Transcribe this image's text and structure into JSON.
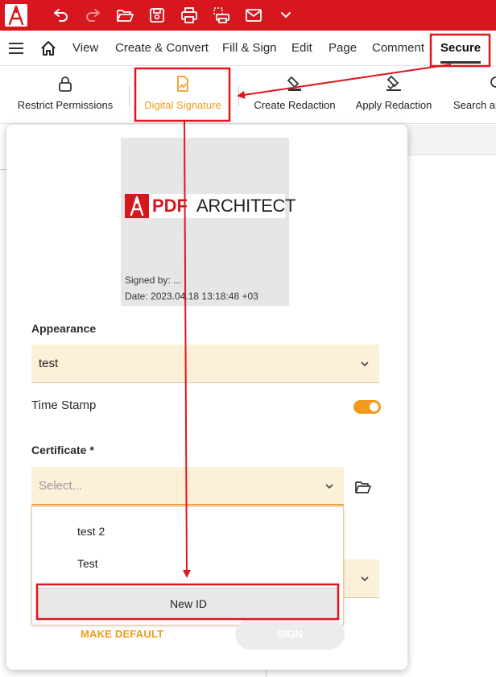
{
  "titlebar": {
    "icons": [
      "app-logo-icon",
      "undo-icon",
      "redo-icon",
      "open-folder-icon",
      "save-icon",
      "print-icon",
      "scan-print-icon",
      "mail-icon",
      "chevron-down-icon"
    ],
    "accent": "#d7161e"
  },
  "menu": {
    "items": [
      "View",
      "Create & Convert",
      "Fill & Sign",
      "Edit",
      "Page",
      "Comment",
      "Secure"
    ],
    "active": "Secure"
  },
  "ribbon": {
    "tools": [
      "Restrict Permissions",
      "Digital Signature",
      "Create Redaction",
      "Apply Redaction",
      "Search ar"
    ]
  },
  "panel": {
    "preview": {
      "brand_pdf": "PDF",
      "brand_arch": "ARCHITECT",
      "signed_by": "Signed by: ...",
      "date": "Date: 2023.04.18 13:18:48 +03"
    },
    "appearance": {
      "label": "Appearance",
      "value": "test"
    },
    "timestamp": {
      "label": "Time Stamp",
      "on": true
    },
    "certificate": {
      "label": "Certificate *",
      "placeholder": "Select...",
      "options": [
        "test 2",
        "Test"
      ],
      "new_id": "New ID"
    },
    "actions": {
      "make_default": "MAKE DEFAULT",
      "sign": "SIGN"
    }
  },
  "colors": {
    "accent": "#f29a1b",
    "brand_red": "#d7161e",
    "field_bg": "#fdf0d8",
    "highlight": "#e0161e"
  }
}
